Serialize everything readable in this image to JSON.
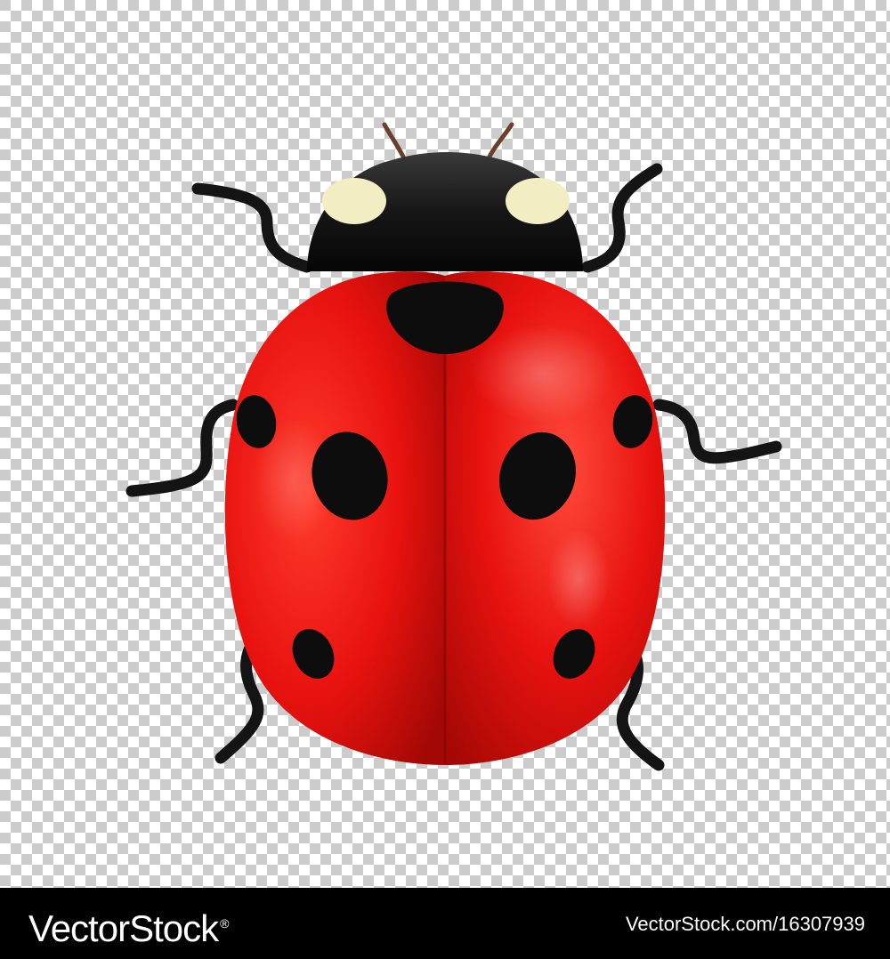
{
  "image": {
    "subject": "ladybug",
    "background": "transparency-checkerboard",
    "colors": {
      "shell_red": "#e8120f",
      "shell_dark": "#a30805",
      "head_black": "#111111",
      "eye_spot": "#f3edc4",
      "leg": "#141414",
      "checker_light": "#ffffff",
      "checker_dark": "#cccccc"
    },
    "spot_count": 7
  },
  "footer": {
    "brand": "VectorStock",
    "registered_mark": "®",
    "image_url": "VectorStock.com/16307939",
    "background": "#000000",
    "text_color": "#ffffff"
  }
}
